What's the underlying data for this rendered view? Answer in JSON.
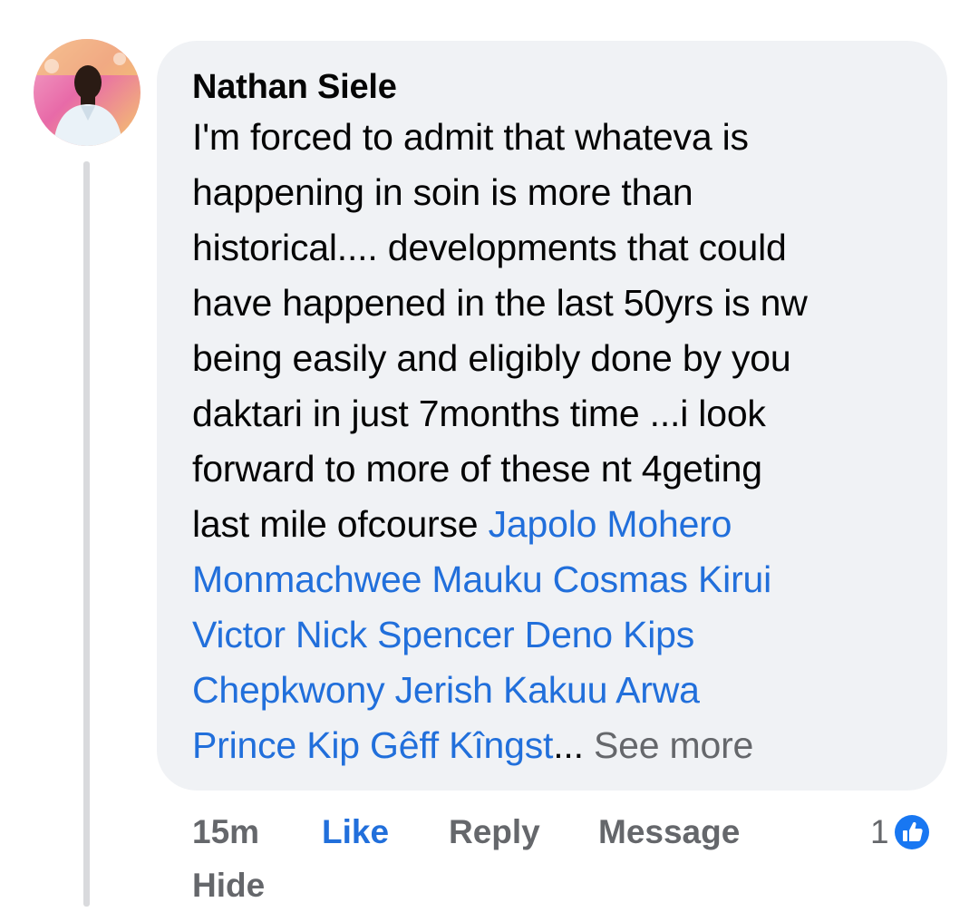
{
  "comment": {
    "author": "Nathan Siele",
    "lines": [
      "I'm forced to admit that whateva is",
      "happening in soin is more than",
      "historical.... developments that could",
      "have happened in the last 50yrs is nw",
      "being easily and eligibly done by you",
      "daktari in just 7months time ...i look",
      "forward to more of these nt 4geting"
    ],
    "last_plain": "last mile ofcourse ",
    "mention_lines": [
      "Japolo Mohero",
      "Monmachwee Mauku Cosmas Kirui",
      "Victor Nick Spencer Deno Kips",
      "Chepkwony Jerish Kakuu Arwa",
      "Prince Kip Gêff Kîngst"
    ],
    "ellipsis": "...",
    "see_more": "See more"
  },
  "actions": {
    "time": "15m",
    "like": "Like",
    "reply": "Reply",
    "message": "Message",
    "hide": "Hide"
  },
  "reactions": {
    "count": "1",
    "icon": "thumbs-up-icon",
    "color": "#1877f2"
  },
  "colors": {
    "bubble": "#f0f2f5",
    "mention": "#216fdb",
    "secondary_text": "#65676b",
    "primary_text": "#050505"
  }
}
